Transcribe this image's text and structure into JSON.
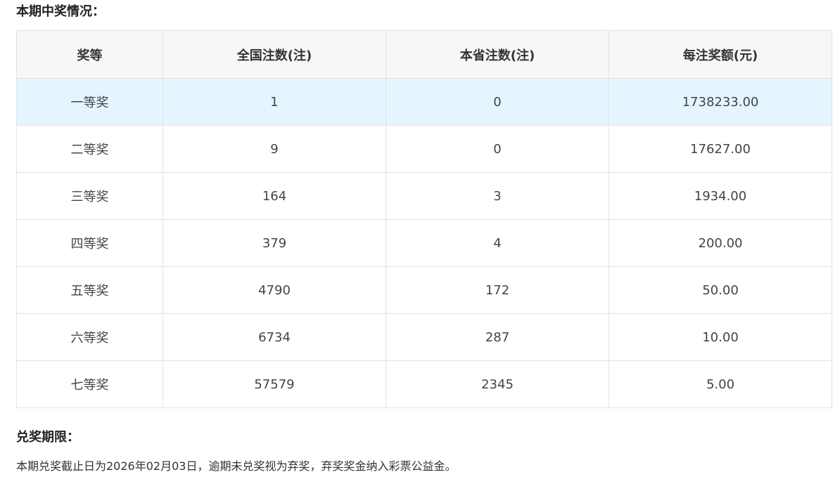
{
  "prize_section": {
    "title": "本期中奖情况："
  },
  "table": {
    "headers": [
      "奖等",
      "全国注数(注)",
      "本省注数(注)",
      "每注奖额(元)"
    ],
    "rows": [
      [
        "一等奖",
        "1",
        "0",
        "1738233.00"
      ],
      [
        "二等奖",
        "9",
        "0",
        "17627.00"
      ],
      [
        "三等奖",
        "164",
        "3",
        "1934.00"
      ],
      [
        "四等奖",
        "379",
        "4",
        "200.00"
      ],
      [
        "五等奖",
        "4790",
        "172",
        "50.00"
      ],
      [
        "六等奖",
        "6734",
        "287",
        "10.00"
      ],
      [
        "七等奖",
        "57579",
        "2345",
        "5.00"
      ]
    ],
    "highlight_color": "#e5f5ff",
    "header_bg": "#f7f7f7"
  },
  "deadline_section": {
    "title": "兑奖期限：",
    "text": "本期兑奖截止日为2026年02月03日，逾期未兑奖视为弃奖，弃奖奖金纳入彩票公益金。"
  }
}
